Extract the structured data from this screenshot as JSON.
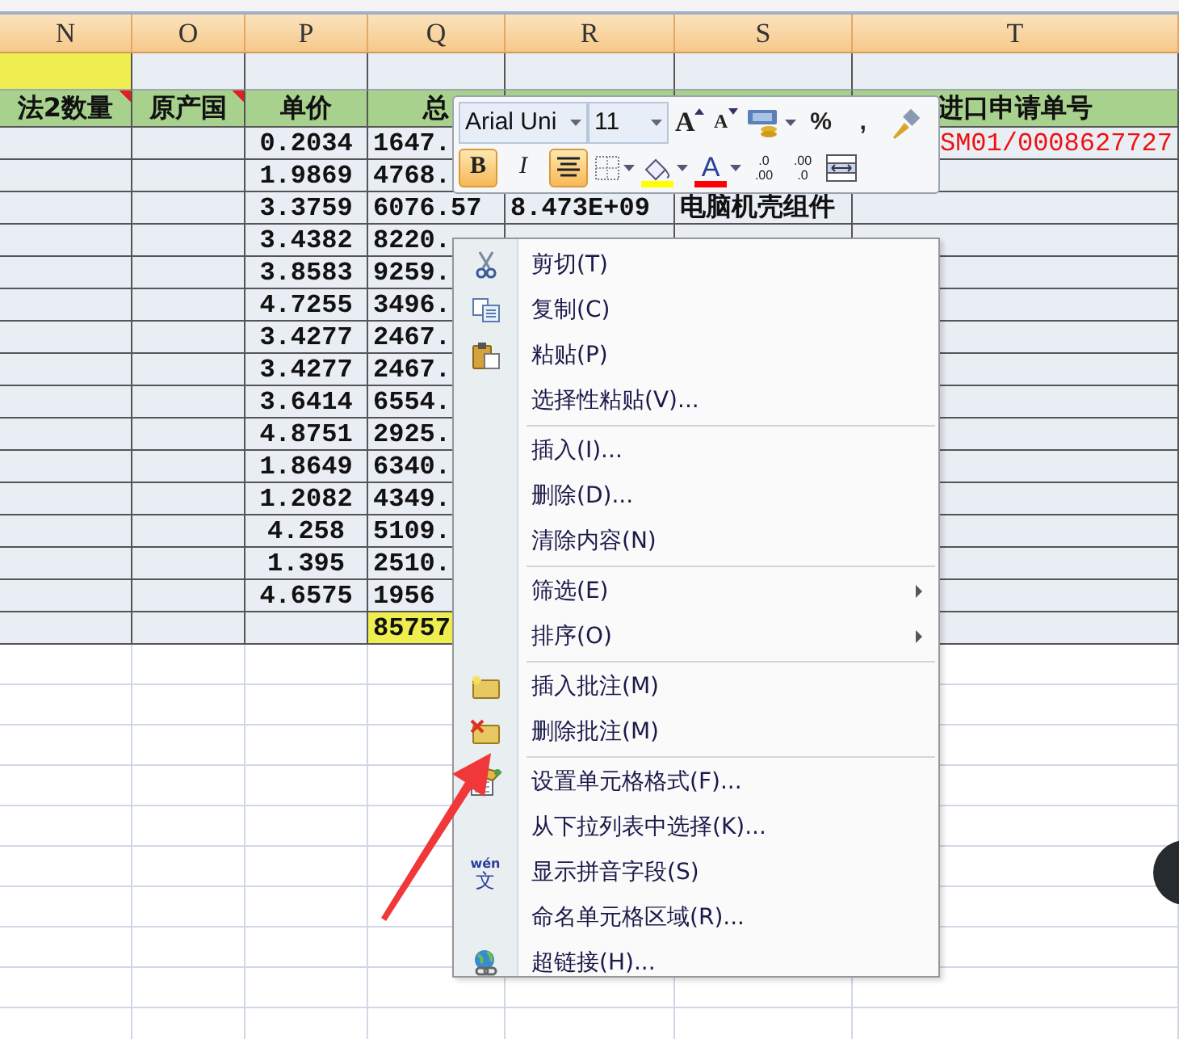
{
  "columns": [
    "N",
    "O",
    "P",
    "Q",
    "R",
    "S",
    "T"
  ],
  "rows": [
    {
      "kind": "blank",
      "cells": [
        {
          "highlighted": true
        },
        {},
        {},
        {},
        {},
        {},
        {}
      ]
    },
    {
      "kind": "header",
      "cells": [
        {
          "text": "法2数量",
          "comment_mark": true
        },
        {
          "text": "原产国",
          "comment_mark": true
        },
        {
          "text": "单价"
        },
        {
          "text": "总"
        },
        {},
        {},
        {
          "text": "进口申请单号"
        }
      ]
    },
    {
      "kind": "data",
      "cells": [
        {},
        {},
        {
          "text": "0.2034"
        },
        {
          "text": "1647."
        },
        {},
        {},
        {
          "text": "SM01/0008627727",
          "red": true
        }
      ]
    },
    {
      "kind": "data",
      "cells": [
        {},
        {},
        {
          "text": "1.9869"
        },
        {
          "text": "4768."
        },
        {},
        {},
        {}
      ]
    },
    {
      "kind": "data",
      "cells": [
        {},
        {},
        {
          "text": "3.3759"
        },
        {
          "text": "6076.57"
        },
        {
          "text": "8.473E+09"
        },
        {
          "text": "电脑机壳组件"
        },
        {}
      ]
    },
    {
      "kind": "data",
      "cells": [
        {},
        {},
        {
          "text": "3.4382"
        },
        {
          "text": "8220."
        },
        {},
        {},
        {}
      ]
    },
    {
      "kind": "data",
      "cells": [
        {},
        {},
        {
          "text": "3.8583"
        },
        {
          "text": "9259."
        },
        {},
        {},
        {}
      ]
    },
    {
      "kind": "data",
      "cells": [
        {},
        {},
        {
          "text": "4.7255"
        },
        {
          "text": "3496."
        },
        {},
        {},
        {}
      ]
    },
    {
      "kind": "data",
      "cells": [
        {},
        {},
        {
          "text": "3.4277"
        },
        {
          "text": "2467."
        },
        {},
        {},
        {}
      ]
    },
    {
      "kind": "data",
      "cells": [
        {},
        {},
        {
          "text": "3.4277"
        },
        {
          "text": "2467."
        },
        {},
        {},
        {}
      ]
    },
    {
      "kind": "data",
      "cells": [
        {},
        {},
        {
          "text": "3.6414"
        },
        {
          "text": "6554."
        },
        {},
        {},
        {}
      ]
    },
    {
      "kind": "data",
      "cells": [
        {},
        {},
        {
          "text": "4.8751"
        },
        {
          "text": "2925."
        },
        {},
        {},
        {}
      ]
    },
    {
      "kind": "data",
      "cells": [
        {},
        {},
        {
          "text": "1.8649"
        },
        {
          "text": "6340."
        },
        {},
        {},
        {}
      ]
    },
    {
      "kind": "data",
      "cells": [
        {},
        {},
        {
          "text": "1.2082"
        },
        {
          "text": "4349."
        },
        {},
        {},
        {}
      ]
    },
    {
      "kind": "data",
      "cells": [
        {},
        {},
        {
          "text": "4.258"
        },
        {
          "text": "5109."
        },
        {},
        {},
        {}
      ]
    },
    {
      "kind": "data",
      "cells": [
        {},
        {},
        {
          "text": "1.395"
        },
        {
          "text": "2510."
        },
        {},
        {},
        {}
      ]
    },
    {
      "kind": "data",
      "cells": [
        {},
        {},
        {
          "text": "4.6575"
        },
        {
          "text": "1956"
        },
        {},
        {},
        {}
      ]
    },
    {
      "kind": "data",
      "cells": [
        {},
        {},
        {},
        {
          "text": "85757",
          "highlighted": true
        },
        {},
        {},
        {}
      ]
    }
  ],
  "mini_toolbar": {
    "font_field": "Arial Uni",
    "size_field": "11",
    "row_1": [
      {
        "kind": "grow-font",
        "label": "A"
      },
      {
        "kind": "shrink-font",
        "label": "A"
      },
      {
        "kind": "accounting"
      },
      {
        "kind": "percent",
        "label": "%"
      },
      {
        "kind": "comma",
        "label": ","
      },
      {
        "kind": "format-painter"
      }
    ],
    "row_2": [
      {
        "kind": "bold",
        "label": "B",
        "selected": true
      },
      {
        "kind": "italic",
        "label": "I",
        "selected": false
      },
      {
        "kind": "center",
        "selected": true
      },
      {
        "kind": "borders"
      },
      {
        "kind": "fill-color",
        "color": "#ffff00"
      },
      {
        "kind": "font-color",
        "label": "A",
        "color": "#ff0000"
      },
      {
        "kind": "increase-decimal",
        "lines": [
          ".0",
          ".00"
        ]
      },
      {
        "kind": "decrease-decimal",
        "lines": [
          ".00",
          ".0"
        ]
      },
      {
        "kind": "merge-center"
      }
    ]
  },
  "context_menu": {
    "groups": [
      [
        {
          "label": "剪切(T)",
          "kind": "scissors"
        },
        {
          "label": "复制(C)",
          "kind": "copy"
        },
        {
          "label": "粘贴(P)",
          "kind": "paste"
        },
        {
          "label": "选择性粘贴(V)...",
          "kind": "plain"
        }
      ],
      [
        {
          "label": "插入(I)...",
          "kind": "plain"
        },
        {
          "label": "删除(D)...",
          "kind": "plain"
        },
        {
          "label": "清除内容(N)",
          "kind": "plain"
        }
      ],
      [
        {
          "label": "筛选(E)",
          "kind": "plain",
          "submenu": true
        },
        {
          "label": "排序(O)",
          "kind": "plain",
          "submenu": true
        }
      ],
      [
        {
          "label": "插入批注(M)",
          "kind": "comment-new"
        },
        {
          "label": "删除批注(M)",
          "kind": "comment-delete"
        }
      ],
      [
        {
          "label": "设置单元格格式(F)...",
          "kind": "format-cells"
        },
        {
          "label": "从下拉列表中选择(K)...",
          "kind": "plain"
        },
        {
          "label": "显示拼音字段(S)",
          "kind": "phonetic",
          "icon_text": [
            "wén",
            "文"
          ]
        },
        {
          "label": "命名单元格区域(R)...",
          "kind": "plain"
        },
        {
          "label": "超链接(H)...",
          "kind": "globe-link"
        }
      ]
    ]
  }
}
